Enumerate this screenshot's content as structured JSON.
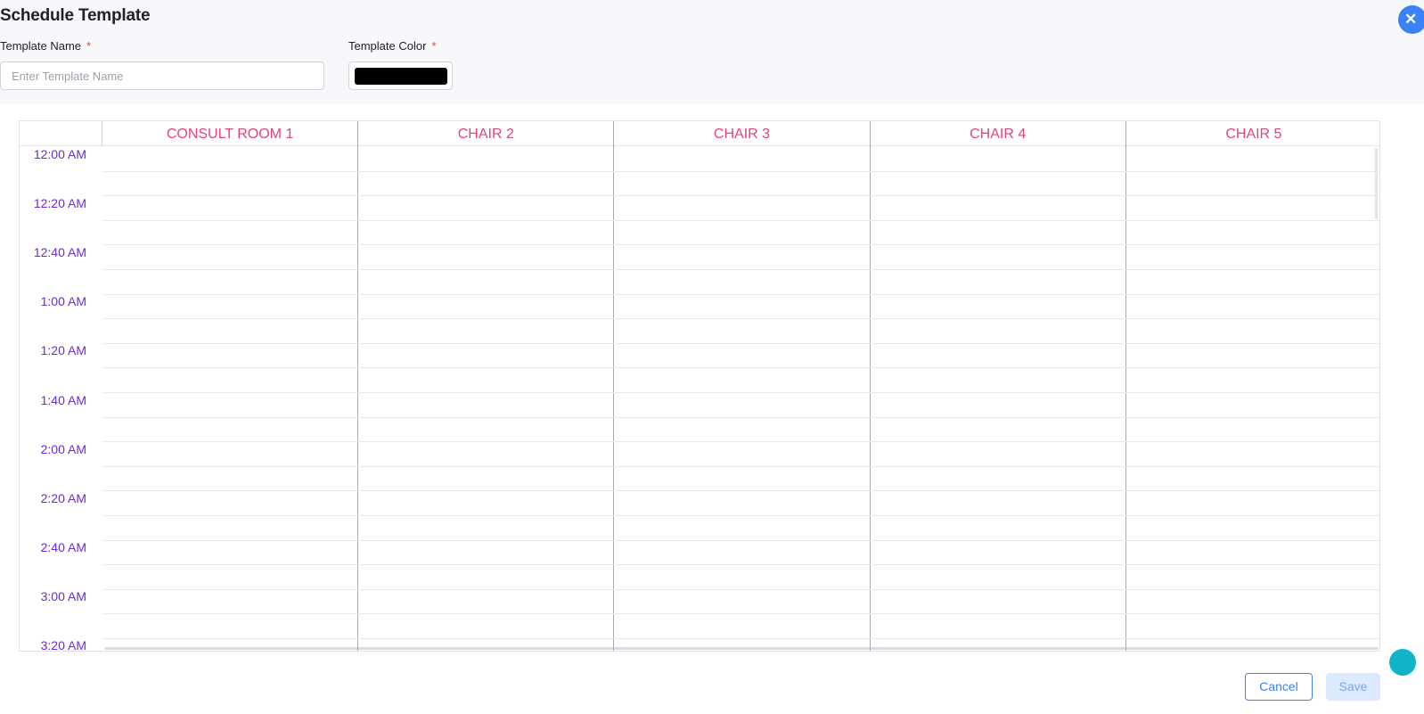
{
  "modal": {
    "title": "Schedule Template",
    "close_icon": "close-icon",
    "close_glyph": "✕"
  },
  "form": {
    "name_label": "Template Name",
    "name_placeholder": "Enter Template Name",
    "name_value": "",
    "color_label": "Template Color",
    "required_mark": "*",
    "color_value": "#000000"
  },
  "schedule": {
    "columns": [
      "CONSULT ROOM 1",
      "CHAIR 2",
      "CHAIR 3",
      "CHAIR 4",
      "CHAIR 5"
    ],
    "time_labels": [
      "12:00 AM",
      "12:20 AM",
      "12:40 AM",
      "1:00 AM",
      "1:20 AM",
      "1:40 AM",
      "2:00 AM",
      "2:20 AM",
      "2:40 AM",
      "3:00 AM",
      "3:20 AM"
    ]
  },
  "footer": {
    "cancel_label": "Cancel",
    "save_label": "Save"
  },
  "colors": {
    "accent": "#3b82f6",
    "column_header": "#e0457b",
    "time_label": "#6d28d9",
    "required": "#ef4444"
  }
}
